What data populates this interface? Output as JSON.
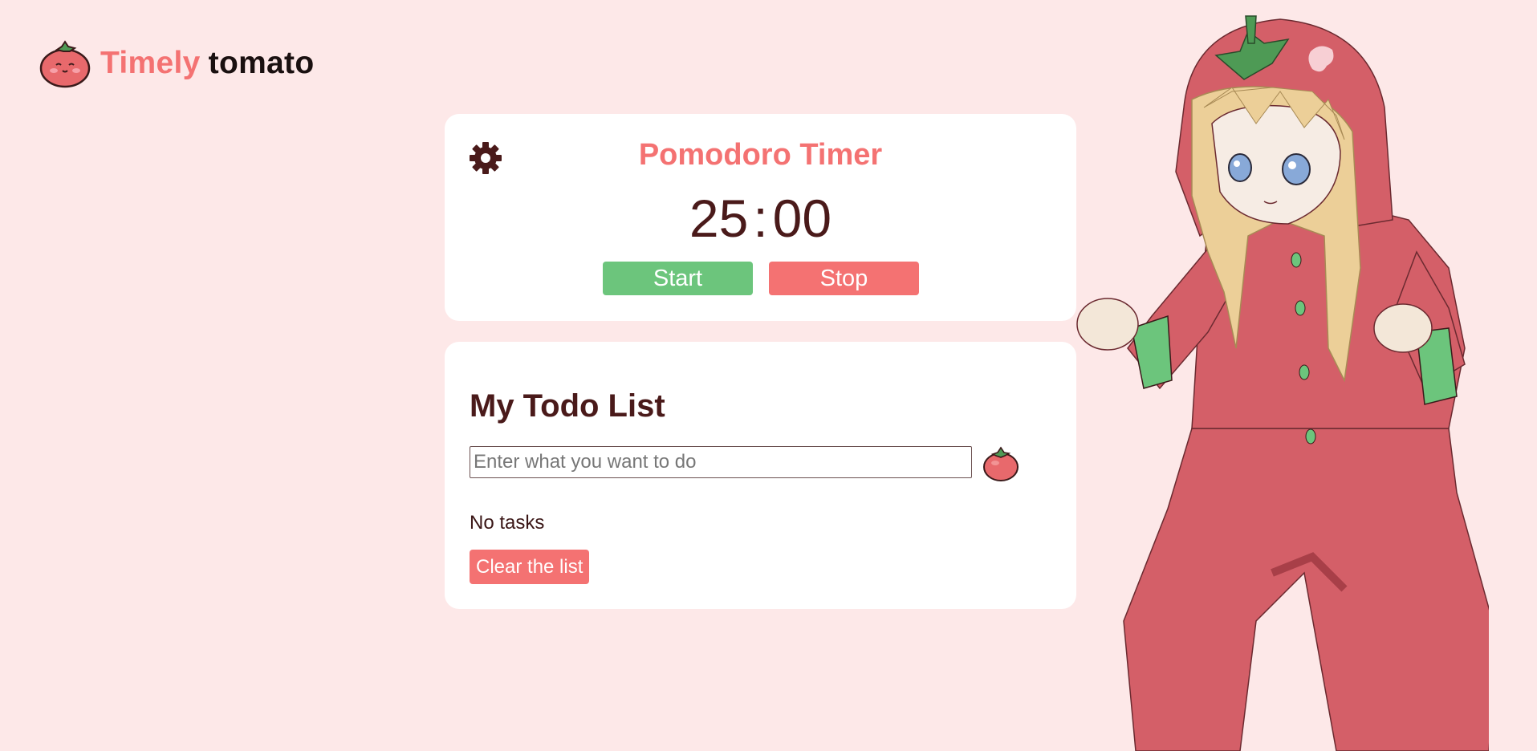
{
  "logo": {
    "word_1": "Timely",
    "word_2": "tomato",
    "icon": "tomato-face-icon"
  },
  "timer": {
    "title": "Pomodoro Timer",
    "minutes": "25",
    "separator": ":",
    "seconds": "00",
    "settings_icon": "gear-icon",
    "start_label": "Start",
    "stop_label": "Stop"
  },
  "todo": {
    "title": "My Todo List",
    "input_placeholder": "Enter what you want to do",
    "input_value": "",
    "add_icon": "tomato-icon",
    "empty_message": "No tasks",
    "clear_label": "Clear the list"
  },
  "mascot": {
    "image": "tomato-girl-illustration"
  },
  "colors": {
    "background": "#fde8e8",
    "accent": "#f47272",
    "start": "#6cc57c",
    "text": "#4a1a1a",
    "card": "#ffffff"
  }
}
